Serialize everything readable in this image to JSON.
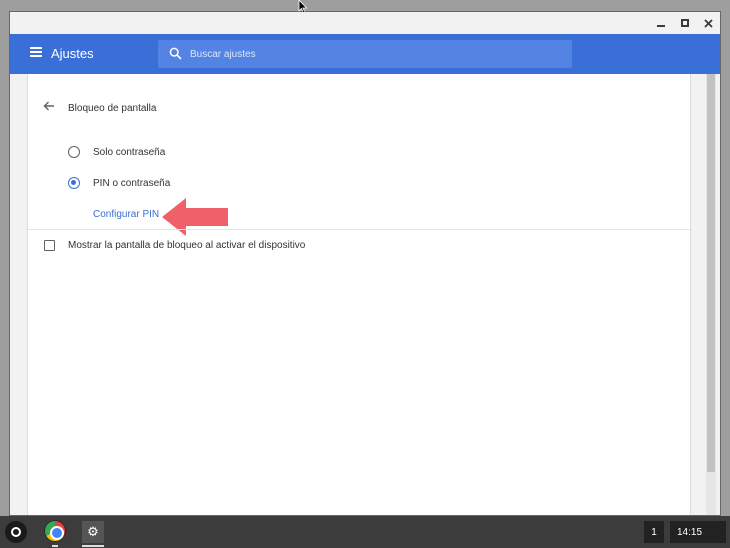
{
  "window": {
    "min_label": "–",
    "max_label": "□",
    "close_label": "✕"
  },
  "appbar": {
    "title": "Ajustes",
    "search_placeholder": "Buscar ajustes"
  },
  "section": {
    "title": "Bloqueo de pantalla",
    "radio_options": [
      {
        "label": "Solo contraseña",
        "checked": false
      },
      {
        "label": "PIN o contraseña",
        "checked": true
      }
    ],
    "configure_link": "Configurar PIN",
    "checkbox_label": "Mostrar la pantalla de bloqueo al activar el dispositivo"
  },
  "shelf": {
    "notification_count": "1",
    "time": "14:15"
  },
  "colors": {
    "accent": "#3a6fd8",
    "arrow": "#f0606a"
  }
}
